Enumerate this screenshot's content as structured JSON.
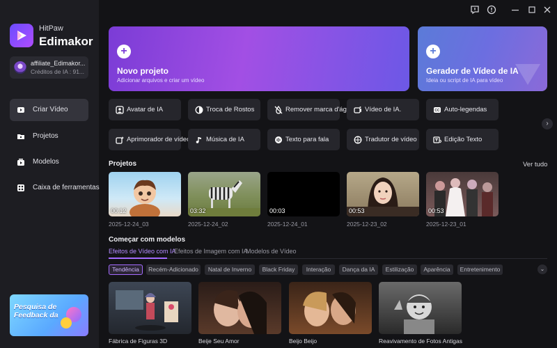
{
  "app": {
    "brand_small": "HitPaw",
    "brand_big": "Edimakor"
  },
  "account": {
    "name": "affiliate_Edimakor...",
    "credits": "Créditos de IA : 91..."
  },
  "sidebar": {
    "items": [
      {
        "label": "Criar Vídeo",
        "icon": "video-icon"
      },
      {
        "label": "Projetos",
        "icon": "folder-icon"
      },
      {
        "label": "Modelos",
        "icon": "templates-icon"
      },
      {
        "label": "Caixa de ferramentas",
        "icon": "toolbox-icon"
      }
    ],
    "feedback": "Pesquisa de Feedback da"
  },
  "hero": {
    "new_project": {
      "title": "Novo projeto",
      "subtitle": "Adicionar arquivos e criar um vídeo"
    },
    "generator": {
      "title": "Gerador de Vídeo de IA",
      "subtitle": "Ideia ou script de IA para vídeo"
    }
  },
  "tools": [
    {
      "label": "Avatar de IA",
      "icon": "avatar-icon"
    },
    {
      "label": "Troca de Rostos",
      "icon": "face-swap-icon"
    },
    {
      "label": "Remover marca d'água",
      "icon": "watermark-icon"
    },
    {
      "label": "Vídeo de IA.",
      "icon": "ai-video-icon"
    },
    {
      "label": "Auto-legendas",
      "icon": "subtitles-icon"
    },
    {
      "label": "Aprimorador de vídeo",
      "icon": "enhancer-icon"
    },
    {
      "label": "Música de IA",
      "icon": "music-icon"
    },
    {
      "label": "Texto para fala",
      "icon": "tts-icon"
    },
    {
      "label": "Tradutor de vídeo",
      "icon": "translate-icon"
    },
    {
      "label": "Edição Texto",
      "icon": "text-edit-icon"
    }
  ],
  "projects": {
    "title": "Projetos",
    "see_all": "Ver tudo",
    "items": [
      {
        "duration": "00:12",
        "date": "2025-12-24_03"
      },
      {
        "duration": "03:32",
        "date": "2025-12-24_02"
      },
      {
        "duration": "00:03",
        "date": "2025-12-24_01"
      },
      {
        "duration": "00:53",
        "date": "2025-12-23_02"
      },
      {
        "duration": "00:53",
        "date": "2025-12-23_01"
      }
    ]
  },
  "templates": {
    "title": "Começar com modelos",
    "tabs": [
      "Efeitos de Vídeo com IA",
      "Efeitos de Imagem com IA",
      "Modelos de Vídeo"
    ],
    "active_tab": "Efeitos de Vídeo com IA",
    "chips": [
      "Tendência",
      "Recém-Adicionado",
      "Natal de Inverno",
      "Black Friday",
      "Interação",
      "Dança da IA",
      "Estilização",
      "Aparência",
      "Entretenimento"
    ],
    "active_chip": "Tendência",
    "items": [
      {
        "label": "Fábrica de Figuras 3D"
      },
      {
        "label": "Beije Seu Amor"
      },
      {
        "label": "Beijo Beijo"
      },
      {
        "label": "Reavivamento de Fotos Antigas"
      }
    ]
  },
  "colors": {
    "accent": "#a46bff",
    "background": "#131316",
    "sidebar": "#1d1d22",
    "card": "#26262c"
  }
}
